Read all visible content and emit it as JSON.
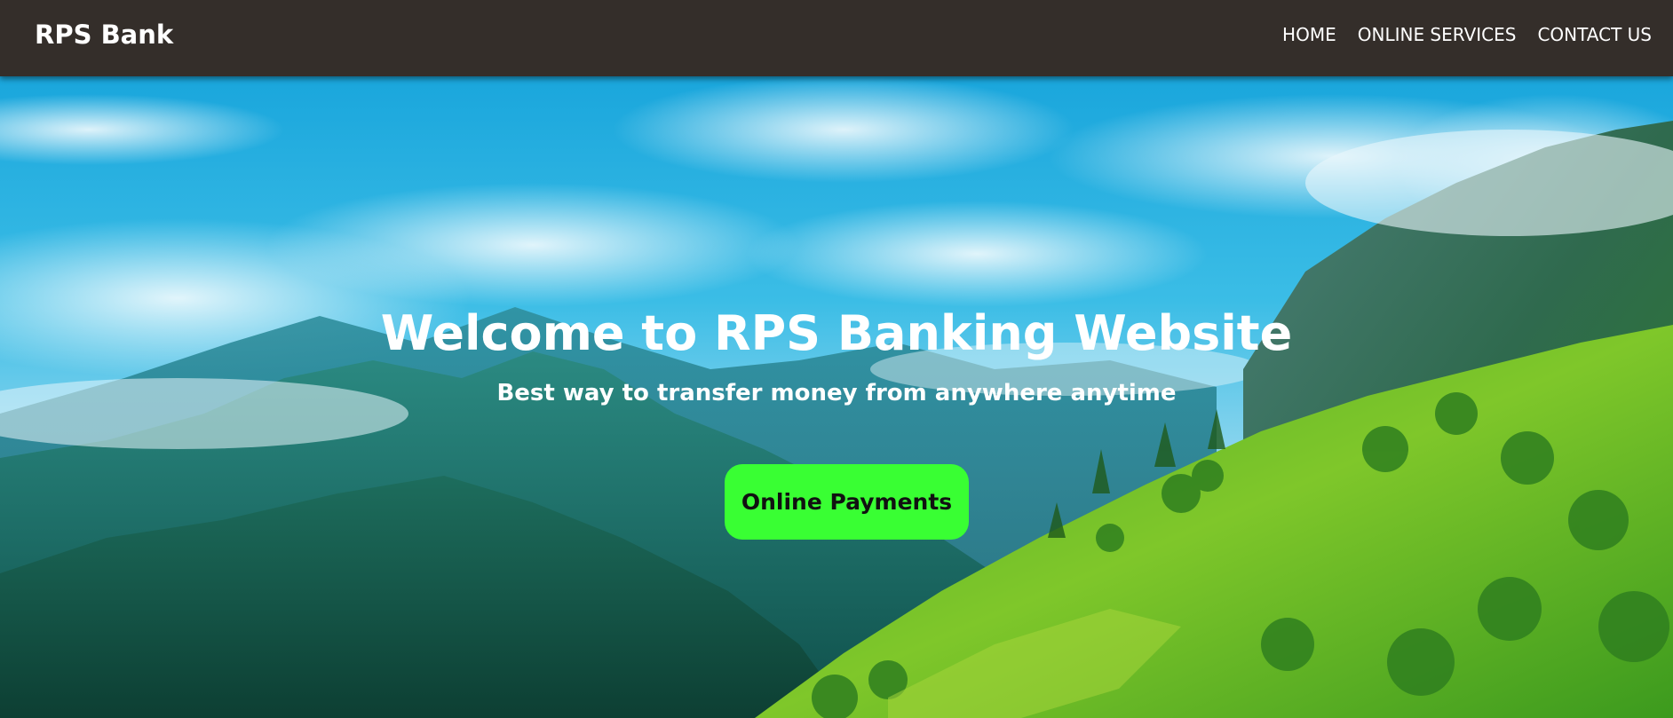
{
  "navbar": {
    "brand": "RPS Bank",
    "links": [
      {
        "label": "HOME"
      },
      {
        "label": "ONLINE SERVICES"
      },
      {
        "label": "CONTACT US"
      }
    ],
    "background_color": "#342e2a"
  },
  "hero": {
    "title": "Welcome to RPS Banking Website",
    "subtitle": "Best way to transfer money from anywhere anytime",
    "cta_label": "Online Payments",
    "cta_color": "#39ff33",
    "background_image": "mountain-landscape"
  }
}
